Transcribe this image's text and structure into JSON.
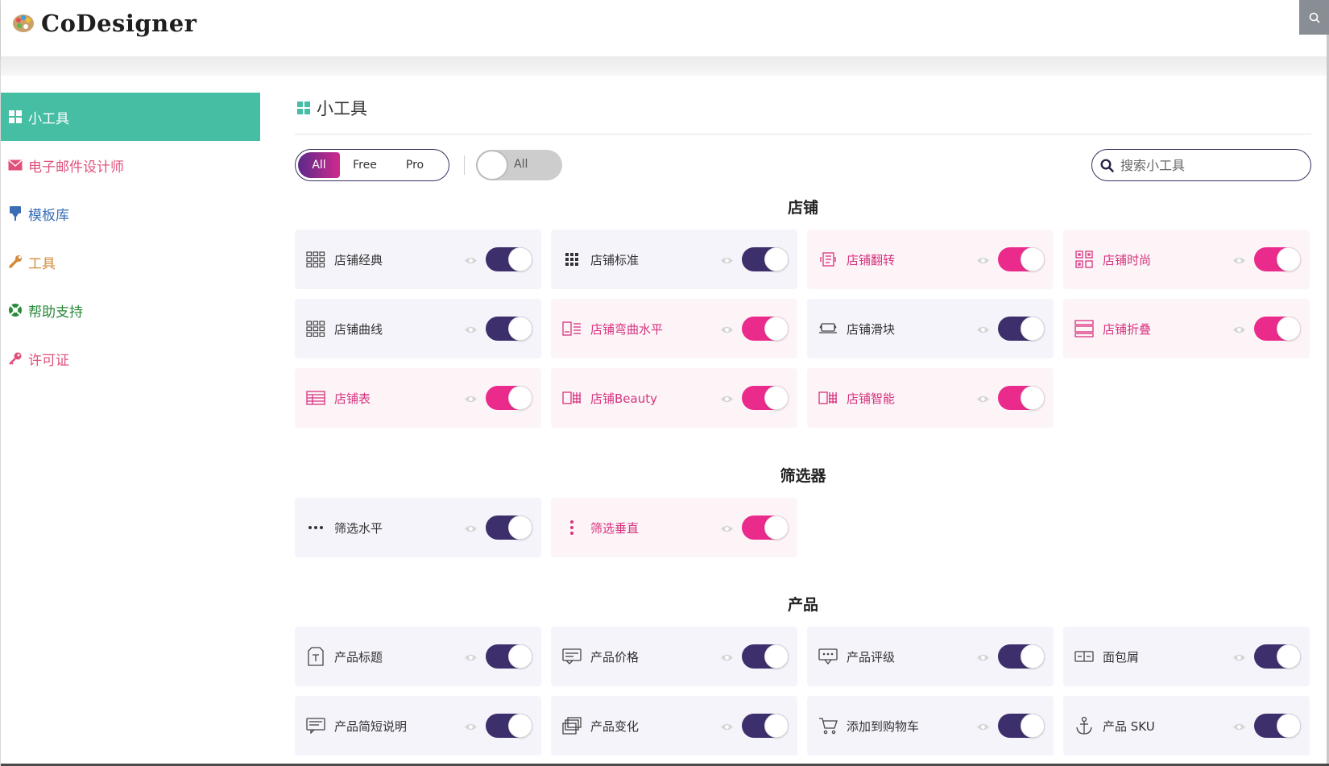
{
  "brand": {
    "name": "CoDesigner",
    "logo_icon": "palette-icon"
  },
  "sidebar": {
    "items": [
      {
        "label": "小工具",
        "icon": "widgets-grid-icon",
        "color": "#ffffff",
        "active": true
      },
      {
        "label": "电子邮件设计师",
        "icon": "envelope-icon",
        "color": "#e0517a"
      },
      {
        "label": "模板库",
        "icon": "template-download-icon",
        "color": "#3a6db5"
      },
      {
        "label": "工具",
        "icon": "wrench-icon",
        "color": "#d48a3c"
      },
      {
        "label": "帮助支持",
        "icon": "lifebuoy-icon",
        "color": "#2a8a3a"
      },
      {
        "label": "许可证",
        "icon": "key-icon",
        "color": "#e0517a"
      }
    ]
  },
  "main": {
    "title": "小工具",
    "filter": {
      "options": [
        "All",
        "Free",
        "Pro"
      ],
      "selected": "All"
    },
    "toggle_all_label": "All",
    "search": {
      "placeholder": "搜索小工具",
      "value": ""
    }
  },
  "sections": [
    {
      "title": "店铺",
      "cards": [
        {
          "label": "店铺经典",
          "tier": "free",
          "icon": "grid-3x3-outline-icon"
        },
        {
          "label": "店铺标准",
          "tier": "free",
          "icon": "grid-3x3-dots-icon"
        },
        {
          "label": "店铺翻转",
          "tier": "pro",
          "icon": "flip-card-icon"
        },
        {
          "label": "店铺时尚",
          "tier": "pro",
          "icon": "qr-grid-icon"
        },
        {
          "label": "店铺曲线",
          "tier": "free",
          "icon": "grid-3x3-outline-icon"
        },
        {
          "label": "店铺弯曲水平",
          "tier": "pro",
          "icon": "curve-horizontal-icon"
        },
        {
          "label": "店铺滑块",
          "tier": "free",
          "icon": "slider-icon"
        },
        {
          "label": "店铺折叠",
          "tier": "pro",
          "icon": "accordion-icon"
        },
        {
          "label": "店铺表",
          "tier": "pro",
          "icon": "table-icon"
        },
        {
          "label": "店铺Beauty",
          "tier": "pro",
          "icon": "beauty-grid-icon"
        },
        {
          "label": "店铺智能",
          "tier": "pro",
          "icon": "smart-grid-icon"
        }
      ]
    },
    {
      "title": "筛选器",
      "cards": [
        {
          "label": "筛选水平",
          "tier": "free",
          "icon": "dots-horizontal-icon"
        },
        {
          "label": "筛选垂直",
          "tier": "pro",
          "icon": "dots-vertical-icon"
        }
      ]
    },
    {
      "title": "产品",
      "cards": [
        {
          "label": "产品标题",
          "tier": "free",
          "icon": "title-doc-icon"
        },
        {
          "label": "产品价格",
          "tier": "free",
          "icon": "price-tag-icon"
        },
        {
          "label": "产品评级",
          "tier": "free",
          "icon": "rating-icon"
        },
        {
          "label": "面包屑",
          "tier": "free",
          "icon": "breadcrumb-icon"
        },
        {
          "label": "产品简短说明",
          "tier": "free",
          "icon": "short-description-icon"
        },
        {
          "label": "产品变化",
          "tier": "free",
          "icon": "variation-icon"
        },
        {
          "label": "添加到购物车",
          "tier": "free",
          "icon": "cart-icon"
        },
        {
          "label": "产品 SKU",
          "tier": "free",
          "icon": "anchor-icon"
        }
      ]
    }
  ],
  "colors": {
    "accent_green": "#45bea4",
    "free_toggle": "#3d2f6c",
    "pro_toggle": "#ea2b8c",
    "pro_text": "#d6337f"
  }
}
